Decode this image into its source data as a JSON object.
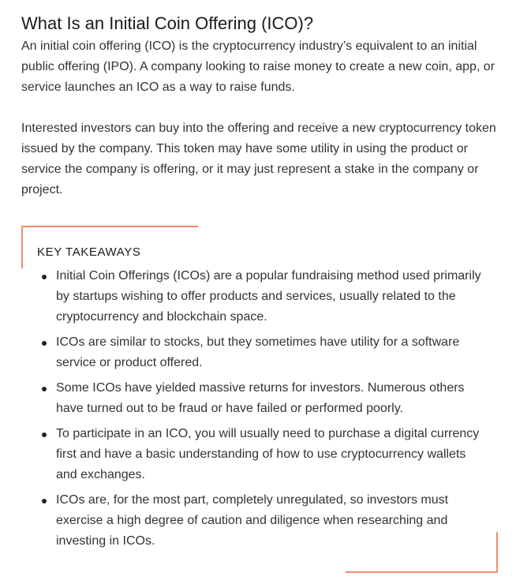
{
  "article": {
    "title": "What Is an Initial Coin Offering (ICO)?",
    "paragraphs": [
      "An initial coin offering (ICO) is the cryptocurrency industry’s equivalent to an initial public offering (IPO). A company looking to raise money to create a new coin, app, or service launches an ICO as a way to raise funds.",
      "Interested investors can buy into the offering and receive a new cryptocurrency token issued by the company. This token may have some utility in using the product or service the company is offering, or it may just represent a stake in the company or project."
    ]
  },
  "takeaways": {
    "heading": "KEY TAKEAWAYS",
    "accent_color": "#f08a6d",
    "items": [
      "Initial Coin Offerings (ICOs) are a popular fundraising method used primarily by startups wishing to offer products and services, usually related to the cryptocurrency and blockchain space.",
      "ICOs are similar to stocks, but they sometimes have utility for a software service or product offered.",
      "Some ICOs have yielded massive returns for investors. Numerous others have turned out to be fraud or have failed or performed poorly.",
      "To participate in an ICO, you will usually need to purchase a digital currency first and have a basic understanding of how to use cryptocurrency wallets and exchanges.",
      "ICOs are, for the most part, completely unregulated, so investors must exercise a high degree of caution and diligence when researching and investing in ICOs."
    ]
  }
}
